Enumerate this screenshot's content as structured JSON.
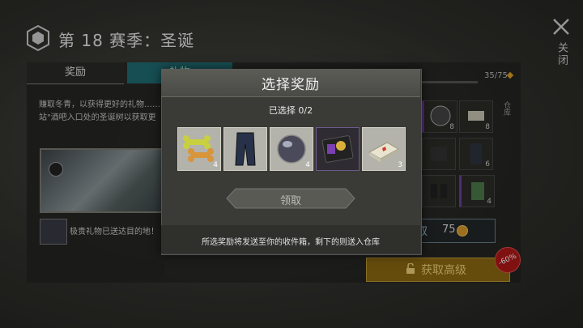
{
  "header": {
    "season_title": "第 18 赛季：圣诞",
    "close_label": "关闭"
  },
  "tabs": [
    {
      "label": "奖励"
    },
    {
      "label": "礼物"
    }
  ],
  "left_panel": {
    "description_line1": "赚取冬青，以获得更好的礼物……",
    "description_line2": "站\"酒吧入口处的圣诞树以获取更",
    "notice_text": "极贵礼物已送达目的地！"
  },
  "progress": {
    "text": "35/75",
    "fraction": 0.4667
  },
  "storage_label": "仓库",
  "right_grid": {
    "counts": [
      "8",
      "8",
      "",
      "6",
      "",
      "",
      "",
      "4"
    ]
  },
  "claim_bar": {
    "label": "领取",
    "amount": "75"
  },
  "premium": {
    "label": "获取高级",
    "discount": "-60%"
  },
  "modal": {
    "title": "选择奖励",
    "selected": "已选择 0/2",
    "items": [
      {
        "icon": "bone-treats-icon",
        "count": "4"
      },
      {
        "icon": "tactical-pants-icon",
        "count": ""
      },
      {
        "icon": "glass-orb-icon",
        "count": "4"
      },
      {
        "icon": "id-badge-icon",
        "count": ""
      },
      {
        "icon": "medkit-box-icon",
        "count": "3"
      }
    ],
    "claim_label": "领取",
    "footer": "所选奖励将发送至你的收件箱，剩下的则送入仓库"
  },
  "colors": {
    "accent_teal": "#1f6c74",
    "premium_gold": "#8c6a12",
    "discount_red": "#b01818",
    "rare_purple": "#6d3fa0"
  }
}
